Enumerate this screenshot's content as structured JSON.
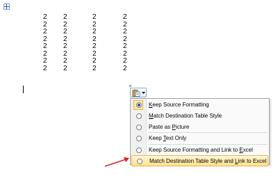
{
  "table": {
    "rows": [
      [
        "2",
        "2",
        "2",
        "2"
      ],
      [
        "2",
        "2",
        "2",
        "2"
      ],
      [
        "2",
        "2",
        "2",
        "2"
      ],
      [
        "2",
        "2",
        "2",
        "2"
      ],
      [
        "2",
        "2",
        "2",
        "2"
      ],
      [
        "2",
        "2",
        "2",
        "2"
      ],
      [
        "2",
        "2",
        "2",
        "2"
      ],
      [
        "2",
        "2",
        "2",
        "2"
      ]
    ]
  },
  "paste_options": {
    "button_icon": "clipboard-icon",
    "items": [
      {
        "pre": "",
        "key": "K",
        "post": "eep Source Formatting",
        "checked": true,
        "highlight": false
      },
      {
        "pre": "",
        "key": "M",
        "post": "atch Destination Table Style",
        "checked": false,
        "highlight": false
      },
      {
        "pre": "Paste as ",
        "key": "P",
        "post": "icture",
        "checked": false,
        "highlight": false
      },
      {
        "pre": "Keep ",
        "key": "T",
        "post": "ext Only",
        "checked": false,
        "highlight": false
      },
      {
        "pre": "Keep Source Formatting and Link to ",
        "key": "E",
        "post": "xcel",
        "checked": false,
        "highlight": false
      },
      {
        "pre": "Match Destination Table Style and ",
        "key": "L",
        "post": "ink to Excel",
        "checked": false,
        "highlight": true
      }
    ]
  },
  "colors": {
    "highlight": "#ffe38c",
    "annotation_arrow": "#e02020"
  }
}
